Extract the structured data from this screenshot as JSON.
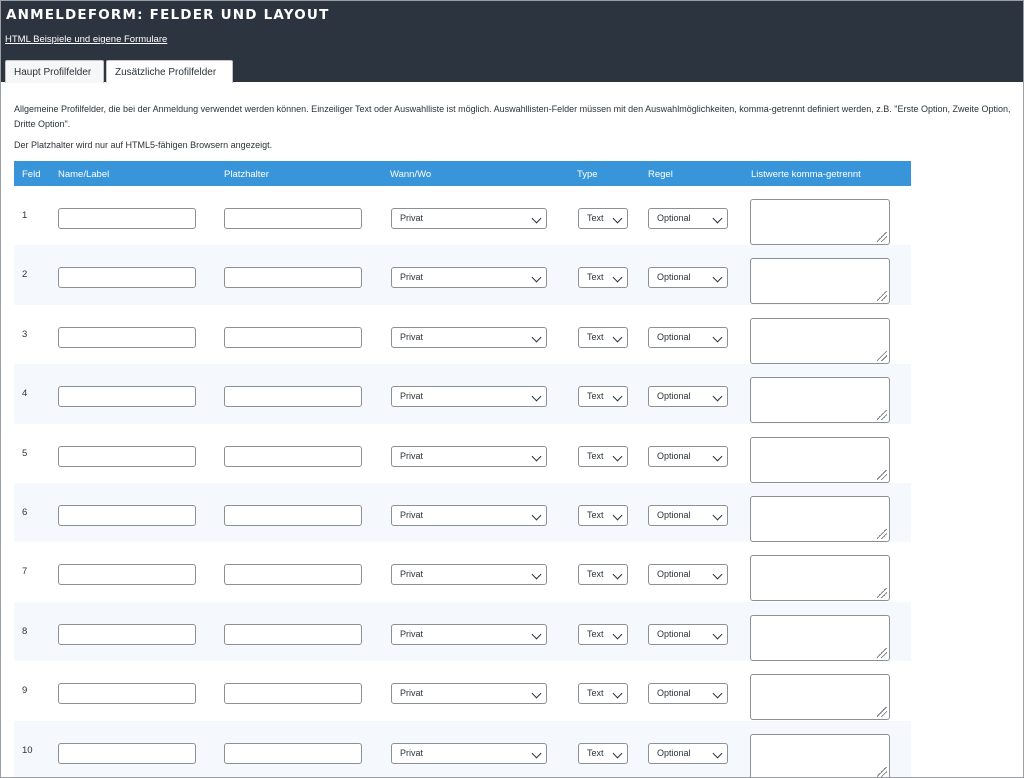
{
  "header": {
    "title": "ANMELDEFORM: FELDER UND LAYOUT",
    "link": "HTML Beispiele und eigene Formulare"
  },
  "tabs": [
    {
      "label": "Haupt Profilfelder",
      "active": true
    },
    {
      "label": "Zusätzliche Profilfelder",
      "active": false
    }
  ],
  "description": "Allgemeine Profilfelder, die bei der Anmeldung verwendet werden können. Einzeiliger Text oder Auswahlliste ist möglich. Auswahllisten-Felder müssen mit den Auswahlmöglichkeiten, komma-getrennt definiert werden, z.B. \"Erste Option, Zweite Option, Dritte Option\".",
  "note": "Der Platzhalter wird nur auf HTML5-fähigen Browsern angezeigt.",
  "table": {
    "headers": [
      "Feld",
      "Name/Label",
      "Platzhalter",
      "Wann/Wo",
      "Type",
      "Regel",
      "Listwerte komma-getrennt"
    ],
    "rows": [
      {
        "num": "1",
        "wann": "Privat",
        "type": "Text",
        "regel": "Optional"
      },
      {
        "num": "2",
        "wann": "Privat",
        "type": "Text",
        "regel": "Optional"
      },
      {
        "num": "3",
        "wann": "Privat",
        "type": "Text",
        "regel": "Optional"
      },
      {
        "num": "4",
        "wann": "Privat",
        "type": "Text",
        "regel": "Optional"
      },
      {
        "num": "5",
        "wann": "Privat",
        "type": "Text",
        "regel": "Optional"
      },
      {
        "num": "6",
        "wann": "Privat",
        "type": "Text",
        "regel": "Optional"
      },
      {
        "num": "7",
        "wann": "Privat",
        "type": "Text",
        "regel": "Optional"
      },
      {
        "num": "8",
        "wann": "Privat",
        "type": "Text",
        "regel": "Optional"
      },
      {
        "num": "9",
        "wann": "Privat",
        "type": "Text",
        "regel": "Optional"
      },
      {
        "num": "10",
        "wann": "Privat",
        "type": "Text",
        "regel": "Optional"
      }
    ]
  },
  "colors": {
    "header_bg": "#2c3440",
    "table_header": "#3895d9"
  }
}
